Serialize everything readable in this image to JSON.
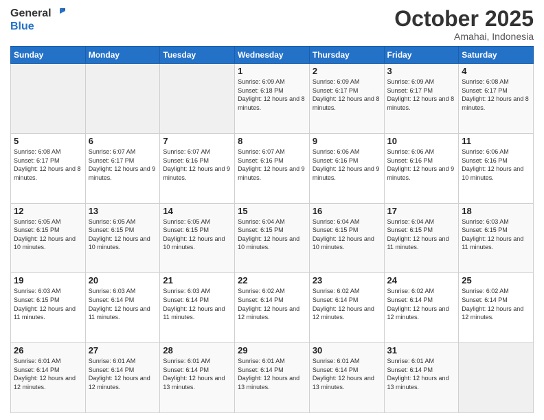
{
  "header": {
    "logo_line1": "General",
    "logo_line2": "Blue",
    "main_title": "October 2025",
    "subtitle": "Amahai, Indonesia"
  },
  "calendar": {
    "days_of_week": [
      "Sunday",
      "Monday",
      "Tuesday",
      "Wednesday",
      "Thursday",
      "Friday",
      "Saturday"
    ],
    "weeks": [
      [
        {
          "day": "",
          "info": ""
        },
        {
          "day": "",
          "info": ""
        },
        {
          "day": "",
          "info": ""
        },
        {
          "day": "1",
          "info": "Sunrise: 6:09 AM\nSunset: 6:18 PM\nDaylight: 12 hours and 8 minutes."
        },
        {
          "day": "2",
          "info": "Sunrise: 6:09 AM\nSunset: 6:17 PM\nDaylight: 12 hours and 8 minutes."
        },
        {
          "day": "3",
          "info": "Sunrise: 6:09 AM\nSunset: 6:17 PM\nDaylight: 12 hours and 8 minutes."
        },
        {
          "day": "4",
          "info": "Sunrise: 6:08 AM\nSunset: 6:17 PM\nDaylight: 12 hours and 8 minutes."
        }
      ],
      [
        {
          "day": "5",
          "info": "Sunrise: 6:08 AM\nSunset: 6:17 PM\nDaylight: 12 hours and 8 minutes."
        },
        {
          "day": "6",
          "info": "Sunrise: 6:07 AM\nSunset: 6:17 PM\nDaylight: 12 hours and 9 minutes."
        },
        {
          "day": "7",
          "info": "Sunrise: 6:07 AM\nSunset: 6:16 PM\nDaylight: 12 hours and 9 minutes."
        },
        {
          "day": "8",
          "info": "Sunrise: 6:07 AM\nSunset: 6:16 PM\nDaylight: 12 hours and 9 minutes."
        },
        {
          "day": "9",
          "info": "Sunrise: 6:06 AM\nSunset: 6:16 PM\nDaylight: 12 hours and 9 minutes."
        },
        {
          "day": "10",
          "info": "Sunrise: 6:06 AM\nSunset: 6:16 PM\nDaylight: 12 hours and 9 minutes."
        },
        {
          "day": "11",
          "info": "Sunrise: 6:06 AM\nSunset: 6:16 PM\nDaylight: 12 hours and 10 minutes."
        }
      ],
      [
        {
          "day": "12",
          "info": "Sunrise: 6:05 AM\nSunset: 6:15 PM\nDaylight: 12 hours and 10 minutes."
        },
        {
          "day": "13",
          "info": "Sunrise: 6:05 AM\nSunset: 6:15 PM\nDaylight: 12 hours and 10 minutes."
        },
        {
          "day": "14",
          "info": "Sunrise: 6:05 AM\nSunset: 6:15 PM\nDaylight: 12 hours and 10 minutes."
        },
        {
          "day": "15",
          "info": "Sunrise: 6:04 AM\nSunset: 6:15 PM\nDaylight: 12 hours and 10 minutes."
        },
        {
          "day": "16",
          "info": "Sunrise: 6:04 AM\nSunset: 6:15 PM\nDaylight: 12 hours and 10 minutes."
        },
        {
          "day": "17",
          "info": "Sunrise: 6:04 AM\nSunset: 6:15 PM\nDaylight: 12 hours and 11 minutes."
        },
        {
          "day": "18",
          "info": "Sunrise: 6:03 AM\nSunset: 6:15 PM\nDaylight: 12 hours and 11 minutes."
        }
      ],
      [
        {
          "day": "19",
          "info": "Sunrise: 6:03 AM\nSunset: 6:15 PM\nDaylight: 12 hours and 11 minutes."
        },
        {
          "day": "20",
          "info": "Sunrise: 6:03 AM\nSunset: 6:14 PM\nDaylight: 12 hours and 11 minutes."
        },
        {
          "day": "21",
          "info": "Sunrise: 6:03 AM\nSunset: 6:14 PM\nDaylight: 12 hours and 11 minutes."
        },
        {
          "day": "22",
          "info": "Sunrise: 6:02 AM\nSunset: 6:14 PM\nDaylight: 12 hours and 12 minutes."
        },
        {
          "day": "23",
          "info": "Sunrise: 6:02 AM\nSunset: 6:14 PM\nDaylight: 12 hours and 12 minutes."
        },
        {
          "day": "24",
          "info": "Sunrise: 6:02 AM\nSunset: 6:14 PM\nDaylight: 12 hours and 12 minutes."
        },
        {
          "day": "25",
          "info": "Sunrise: 6:02 AM\nSunset: 6:14 PM\nDaylight: 12 hours and 12 minutes."
        }
      ],
      [
        {
          "day": "26",
          "info": "Sunrise: 6:01 AM\nSunset: 6:14 PM\nDaylight: 12 hours and 12 minutes."
        },
        {
          "day": "27",
          "info": "Sunrise: 6:01 AM\nSunset: 6:14 PM\nDaylight: 12 hours and 12 minutes."
        },
        {
          "day": "28",
          "info": "Sunrise: 6:01 AM\nSunset: 6:14 PM\nDaylight: 12 hours and 13 minutes."
        },
        {
          "day": "29",
          "info": "Sunrise: 6:01 AM\nSunset: 6:14 PM\nDaylight: 12 hours and 13 minutes."
        },
        {
          "day": "30",
          "info": "Sunrise: 6:01 AM\nSunset: 6:14 PM\nDaylight: 12 hours and 13 minutes."
        },
        {
          "day": "31",
          "info": "Sunrise: 6:01 AM\nSunset: 6:14 PM\nDaylight: 12 hours and 13 minutes."
        },
        {
          "day": "",
          "info": ""
        }
      ]
    ]
  }
}
